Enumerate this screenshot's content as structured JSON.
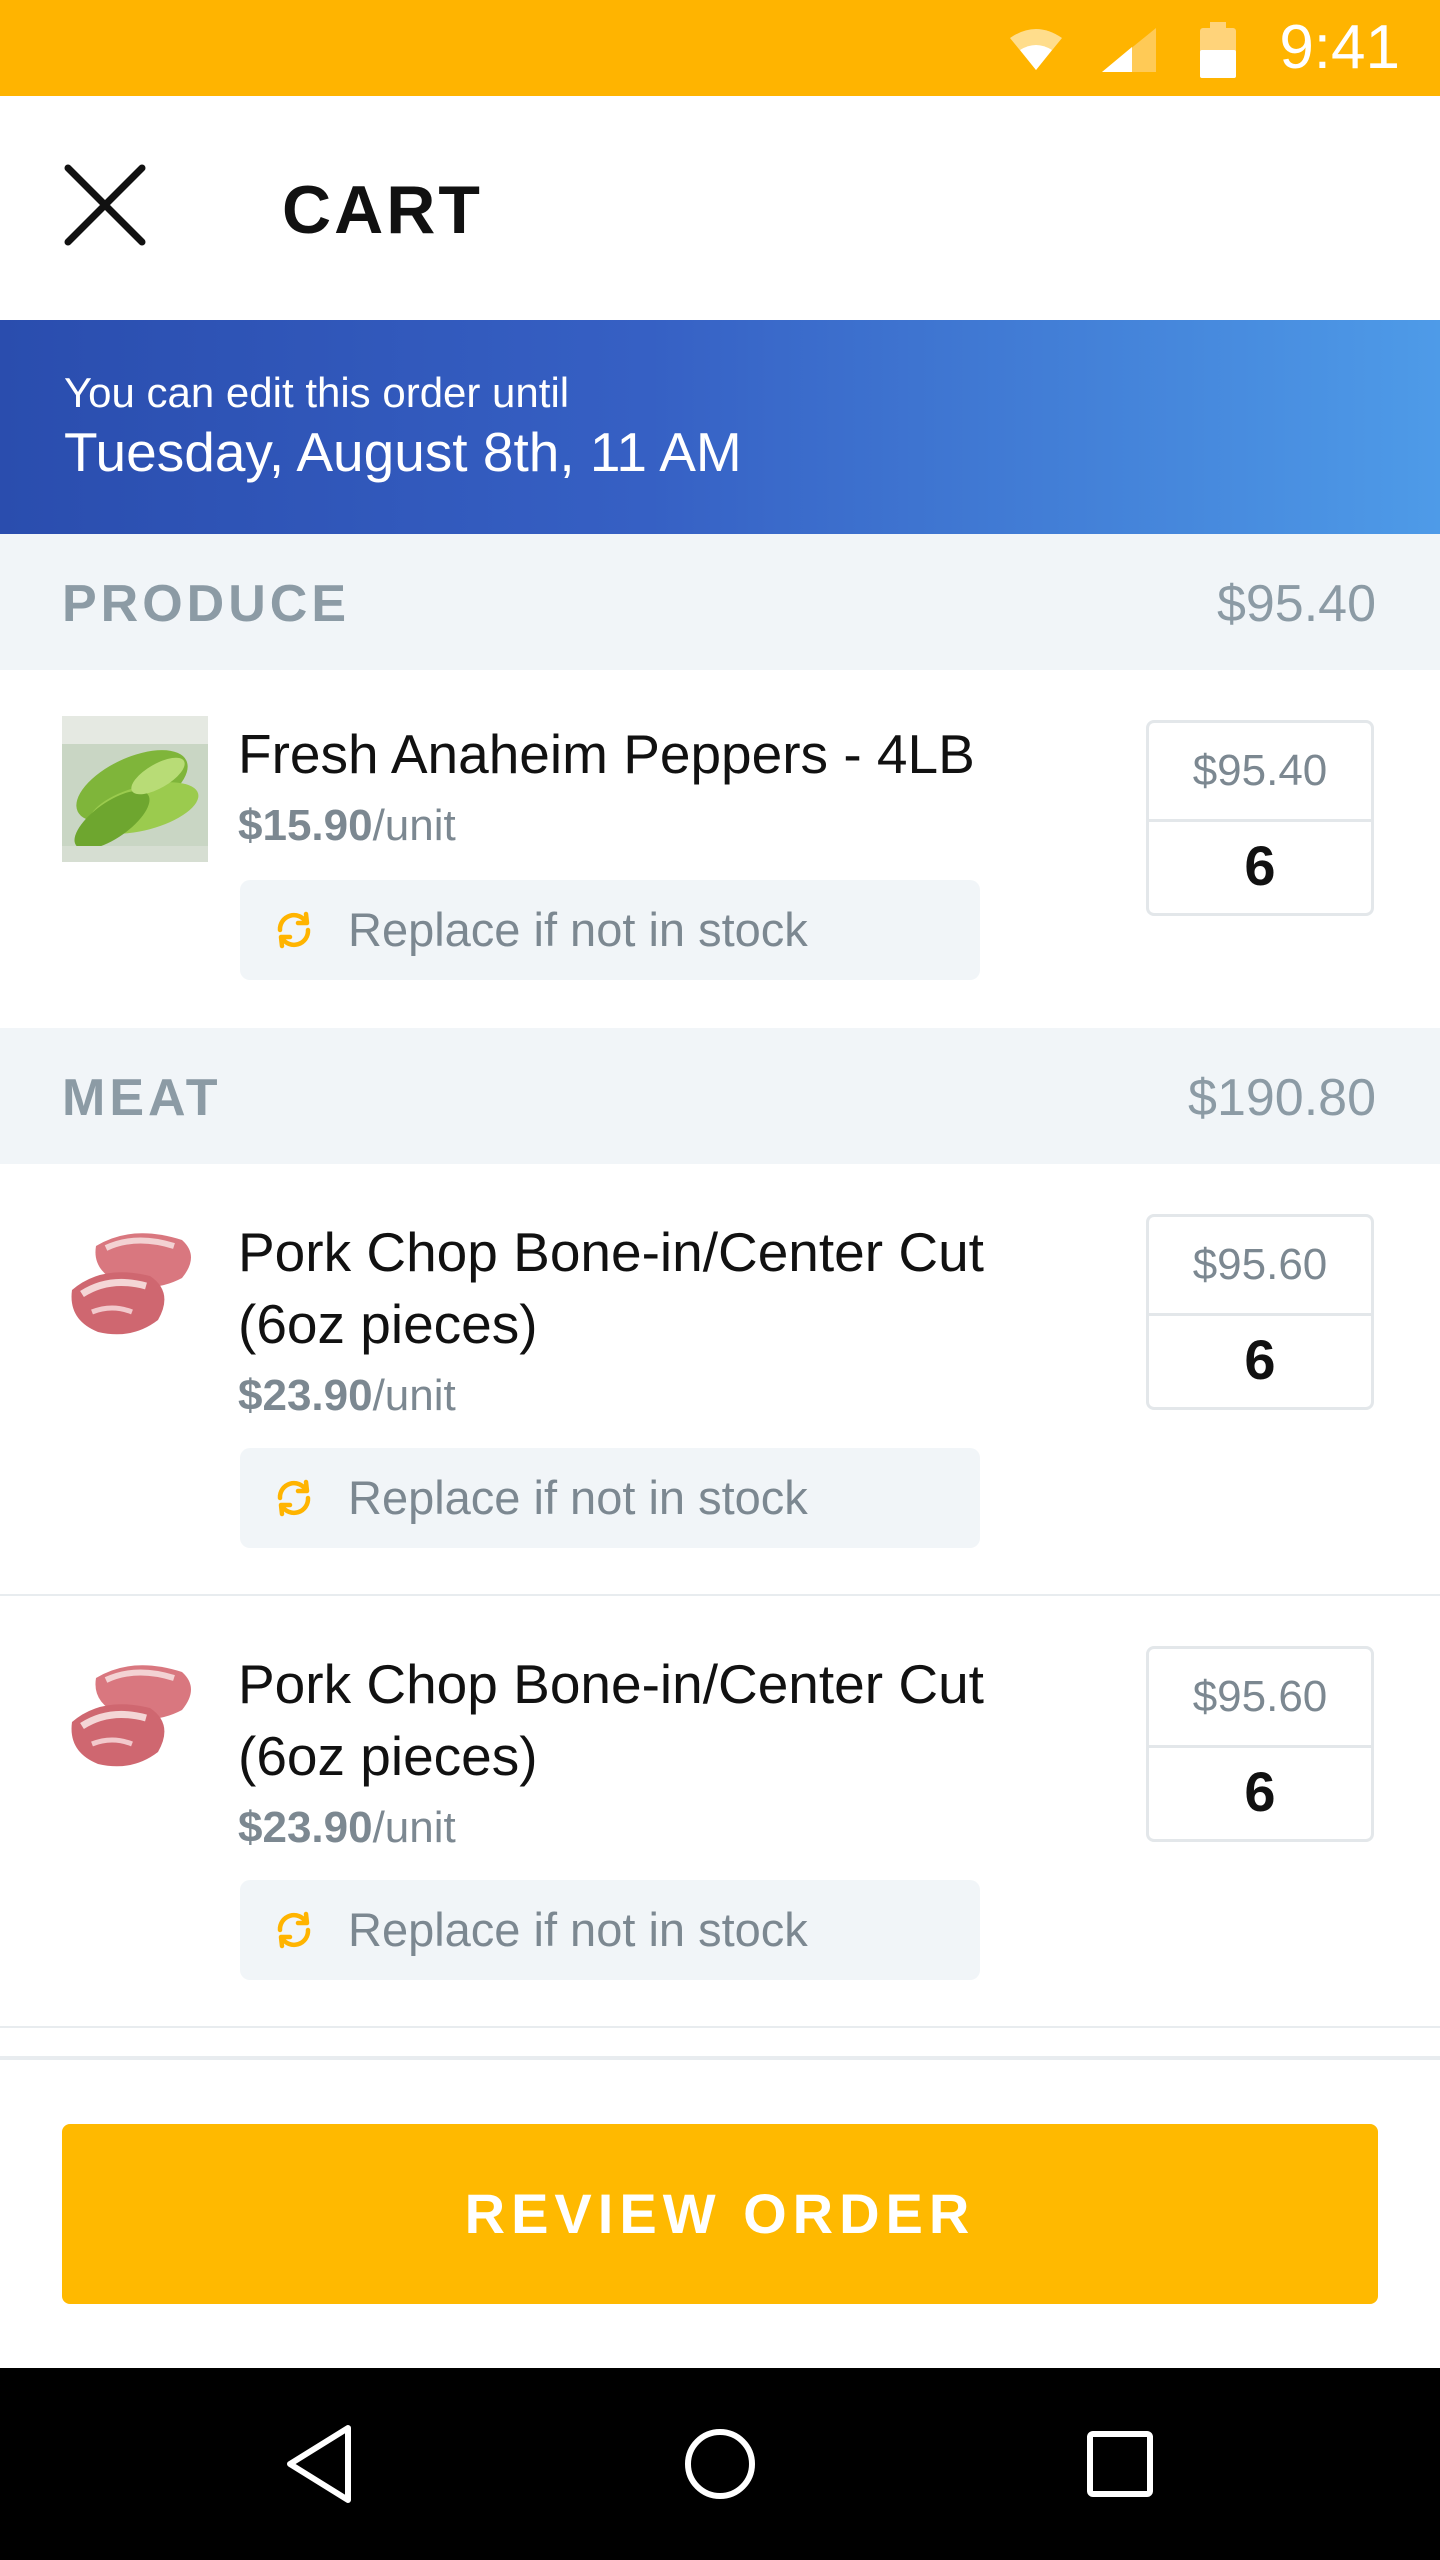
{
  "status_bar": {
    "time": "9:41",
    "color": "#FFB400"
  },
  "header": {
    "title": "CART",
    "close_icon": "close-icon"
  },
  "banner": {
    "line1": "You can edit this order until",
    "line2": "Tuesday, August 8th, 11 AM"
  },
  "sections": [
    {
      "title": "PRODUCE",
      "total": "$95.40",
      "items": [
        {
          "name_lines": [
            "Fresh Anaheim Peppers - 4LB"
          ],
          "unit_price": "$15.90",
          "unit_suffix": "/unit",
          "replace_label": "Replace if not in stock",
          "line_total": "$95.40",
          "quantity": "6",
          "thumbnail": "peppers-thumbnail"
        }
      ]
    },
    {
      "title": "MEAT",
      "total": "$190.80",
      "items": [
        {
          "name_lines": [
            "Pork Chop Bone-in/Center Cut",
            "(6oz pieces)"
          ],
          "unit_price": "$23.90",
          "unit_suffix": "/unit",
          "replace_label": "Replace if not in stock",
          "line_total": "$95.60",
          "quantity": "6",
          "thumbnail": "pork-chop-thumbnail"
        },
        {
          "name_lines": [
            "Pork Chop Bone-in/Center Cut",
            "(6oz pieces)"
          ],
          "unit_price": "$23.90",
          "unit_suffix": "/unit",
          "replace_label": "Replace if not in stock",
          "line_total": "$95.60",
          "quantity": "6",
          "thumbnail": "pork-chop-thumbnail"
        }
      ]
    }
  ],
  "footer": {
    "review_button_label": "REVIEW ORDER",
    "button_color": "#FFB900"
  },
  "nav_bar": {
    "back_icon": "back-triangle-icon",
    "home_icon": "home-circle-icon",
    "recent_icon": "recent-square-icon"
  }
}
